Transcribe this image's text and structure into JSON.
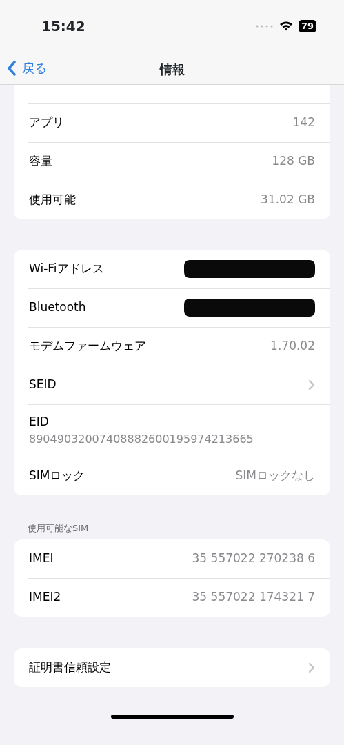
{
  "status_bar": {
    "time": "15:42",
    "battery": "79"
  },
  "nav": {
    "back": "戻る",
    "title": "情報"
  },
  "groups": [
    {
      "rows": [
        {
          "kind": "value",
          "label": "アプリ",
          "value": "142"
        },
        {
          "kind": "value",
          "label": "容量",
          "value": "128 GB"
        },
        {
          "kind": "value",
          "label": "使用可能",
          "value": "31.02 GB"
        }
      ]
    },
    {
      "rows": [
        {
          "kind": "redacted",
          "label": "Wi-Fiアドレス"
        },
        {
          "kind": "redacted",
          "label": "Bluetooth"
        },
        {
          "kind": "value",
          "label": "モデムファームウェア",
          "value": "1.70.02"
        },
        {
          "kind": "link",
          "label": "SEID"
        },
        {
          "kind": "stacked",
          "label": "EID",
          "value": "89049032007408882600195974213665"
        },
        {
          "kind": "value",
          "label": "SIMロック",
          "value": "SIMロックなし"
        }
      ]
    },
    {
      "header": "使用可能なSIM",
      "rows": [
        {
          "kind": "value",
          "label": "IMEI",
          "value": "35 557022 270238 6"
        },
        {
          "kind": "value",
          "label": "IMEI2",
          "value": "35 557022 174321 7"
        }
      ]
    },
    {
      "rows": [
        {
          "kind": "link",
          "label": "証明書信頼設定"
        }
      ]
    }
  ]
}
